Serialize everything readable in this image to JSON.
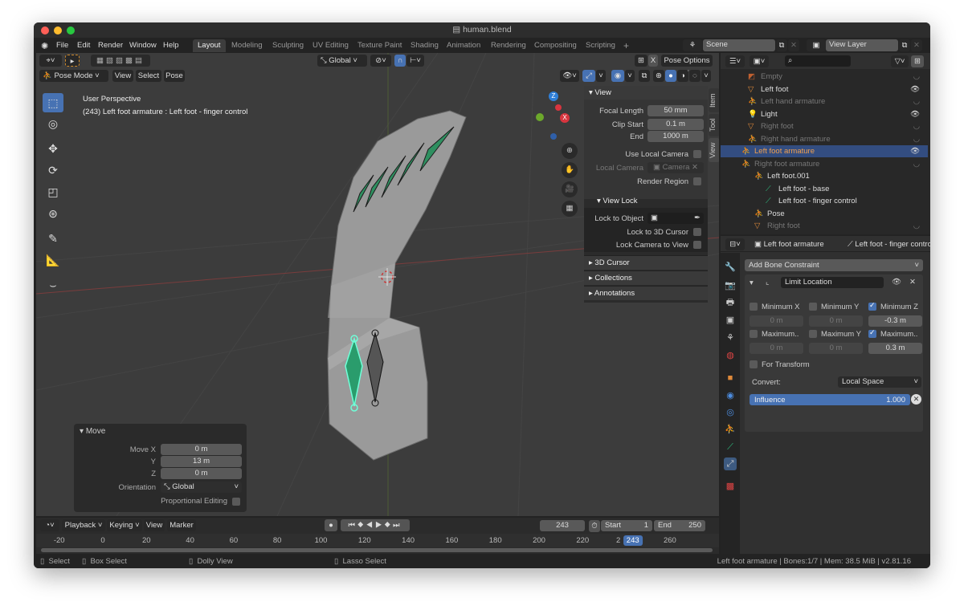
{
  "window": {
    "title": "human.blend"
  },
  "menu": [
    "File",
    "Edit",
    "Render",
    "Window",
    "Help"
  ],
  "workspaces": [
    "Layout",
    "Modeling",
    "Sculpting",
    "UV Editing",
    "Texture Paint",
    "Shading",
    "Animation",
    "Rendering",
    "Compositing",
    "Scripting",
    "+"
  ],
  "scene": {
    "name": "Scene",
    "view_layer": "View Layer"
  },
  "viewport": {
    "header": {
      "orientation": "Global",
      "pose_options": "Pose Options",
      "mode": "Pose Mode",
      "menus": [
        "View",
        "Select",
        "Pose"
      ]
    },
    "overlay_text": {
      "perspective": "User Perspective",
      "selection": "(243) Left foot armature : Left foot - finger control"
    },
    "gizmo": {
      "x": "X",
      "y": "Y",
      "z": "Z"
    },
    "sidebar": {
      "tabs": [
        "Item",
        "Tool",
        "View"
      ],
      "active_tab": "View",
      "view_title": "View",
      "focal_length_label": "Focal Length",
      "focal_length": "50 mm",
      "clip_start_label": "Clip Start",
      "clip_start": "0.1 m",
      "end_label": "End",
      "end": "1000 m",
      "use_local_camera": "Use Local Camera",
      "local_camera_label": "Local Camera",
      "local_camera": "Camera",
      "render_region": "Render Region",
      "view_lock_title": "View Lock",
      "lock_to_object": "Lock to Object",
      "lock_3d_cursor": "Lock to 3D Cursor",
      "lock_camera": "Lock Camera to View",
      "collapsed": [
        "3D Cursor",
        "Collections",
        "Annotations"
      ]
    },
    "move_panel": {
      "title": "Move",
      "move_x_label": "Move X",
      "move_x": "0 m",
      "y_label": "Y",
      "y": "13 m",
      "z_label": "Z",
      "z": "0 m",
      "orientation_label": "Orientation",
      "orientation": "Global",
      "proportional": "Proportional Editing"
    }
  },
  "outliner": {
    "rows": [
      {
        "label": "Empty",
        "dim": true
      },
      {
        "label": "Left foot",
        "dim": false
      },
      {
        "label": "Left hand armature",
        "dim": true
      },
      {
        "label": "Light",
        "dim": false
      },
      {
        "label": "Right foot",
        "dim": true
      },
      {
        "label": "Right hand armature",
        "dim": true
      },
      {
        "label": "Left foot armature",
        "selected": true
      },
      {
        "label": "Right foot armature",
        "dim": true
      },
      {
        "label": "Left foot.001"
      },
      {
        "label": "Left foot - base"
      },
      {
        "label": "Left foot - finger control"
      },
      {
        "label": "Pose"
      },
      {
        "label": "Right foot",
        "dim": true
      }
    ]
  },
  "properties": {
    "breadcrumb": [
      "Left foot armature",
      "Left foot - finger control"
    ],
    "add_constraint": "Add Bone Constraint",
    "constraint": {
      "name": "Limit Location",
      "min_x": {
        "label": "Minimum X",
        "checked": false,
        "value": "0 m"
      },
      "min_y": {
        "label": "Minimum Y",
        "checked": false,
        "value": "0 m"
      },
      "min_z": {
        "label": "Minimum Z",
        "checked": true,
        "value": "-0.3 m"
      },
      "max_x": {
        "label": "Maximum..",
        "checked": false,
        "value": "0 m"
      },
      "max_y": {
        "label": "Maximum Y",
        "checked": false,
        "value": "0 m"
      },
      "max_z": {
        "label": "Maximum..",
        "checked": true,
        "value": "0.3 m"
      },
      "for_transform": "For Transform",
      "convert_label": "Convert:",
      "convert": "Local Space",
      "influence_label": "Influence",
      "influence": "1.000"
    }
  },
  "timeline": {
    "menus": [
      "Playback",
      "Keying",
      "View",
      "Marker"
    ],
    "current_frame": "243",
    "start_label": "Start",
    "start": "1",
    "end_label": "End",
    "end": "250",
    "ticks": [
      "-20",
      "0",
      "20",
      "40",
      "60",
      "80",
      "100",
      "120",
      "140",
      "160",
      "180",
      "200",
      "220",
      "2",
      "260"
    ],
    "playhead": "243"
  },
  "statusbar": {
    "hints": [
      "Select",
      "Box Select",
      "Dolly View",
      "Lasso Select"
    ],
    "info": "Left foot armature | Bones:1/7  | Mem: 38.5 MiB | v2.81.16"
  },
  "colors": {
    "accent": "#4772b3",
    "selected_row": "#334d80",
    "bone_green": "#2fbf80",
    "object_orange": "#e09040"
  }
}
